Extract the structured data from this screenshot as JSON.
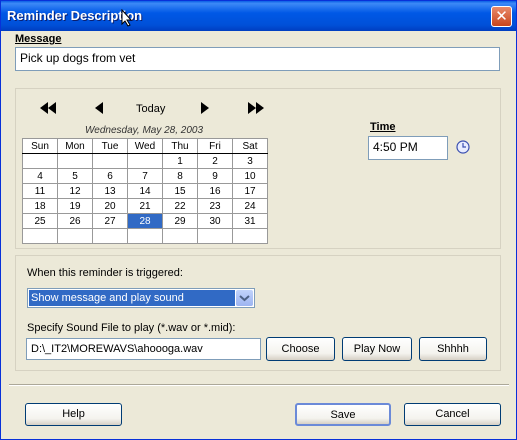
{
  "window": {
    "title": "Reminder Description",
    "close_label": "✕"
  },
  "message": {
    "label": "Message",
    "value": "Pick up dogs from vet"
  },
  "calendar": {
    "prev_year_label": "◀◀",
    "prev_month_label": "◀",
    "today_label": "Today",
    "next_month_label": "▶",
    "next_year_label": "▶▶",
    "selected_date_text": "Wednesday, May 28, 2003",
    "days": [
      "Sun",
      "Mon",
      "Tue",
      "Wed",
      "Thu",
      "Fri",
      "Sat"
    ],
    "weeks": [
      [
        "",
        "",
        "",
        "",
        "1",
        "2",
        "3"
      ],
      [
        "4",
        "5",
        "6",
        "7",
        "8",
        "9",
        "10"
      ],
      [
        "11",
        "12",
        "13",
        "14",
        "15",
        "16",
        "17"
      ],
      [
        "18",
        "19",
        "20",
        "21",
        "22",
        "23",
        "24"
      ],
      [
        "25",
        "26",
        "27",
        "28",
        "29",
        "30",
        "31"
      ],
      [
        "",
        "",
        "",
        "",
        "",
        "",
        ""
      ]
    ],
    "selected_day": "28"
  },
  "time": {
    "label": "Time",
    "value": "4:50 PM",
    "icon": "clock-icon"
  },
  "trigger": {
    "label": "When this reminder is triggered:",
    "selected_option": "Show message and play sound"
  },
  "sound": {
    "label": "Specify Sound File to play (*.wav or *.mid):",
    "file_value": "D:\\_IT2\\MOREWAVS\\ahoooga.wav",
    "choose_label": "Choose",
    "play_label": "Play Now",
    "stop_label": "Shhhh"
  },
  "footer": {
    "help_label": "Help",
    "save_label": "Save",
    "cancel_label": "Cancel"
  },
  "colors": {
    "titlebar": "#0054e3",
    "selection": "#316ac5",
    "dialog_bg": "#ece9d8"
  }
}
